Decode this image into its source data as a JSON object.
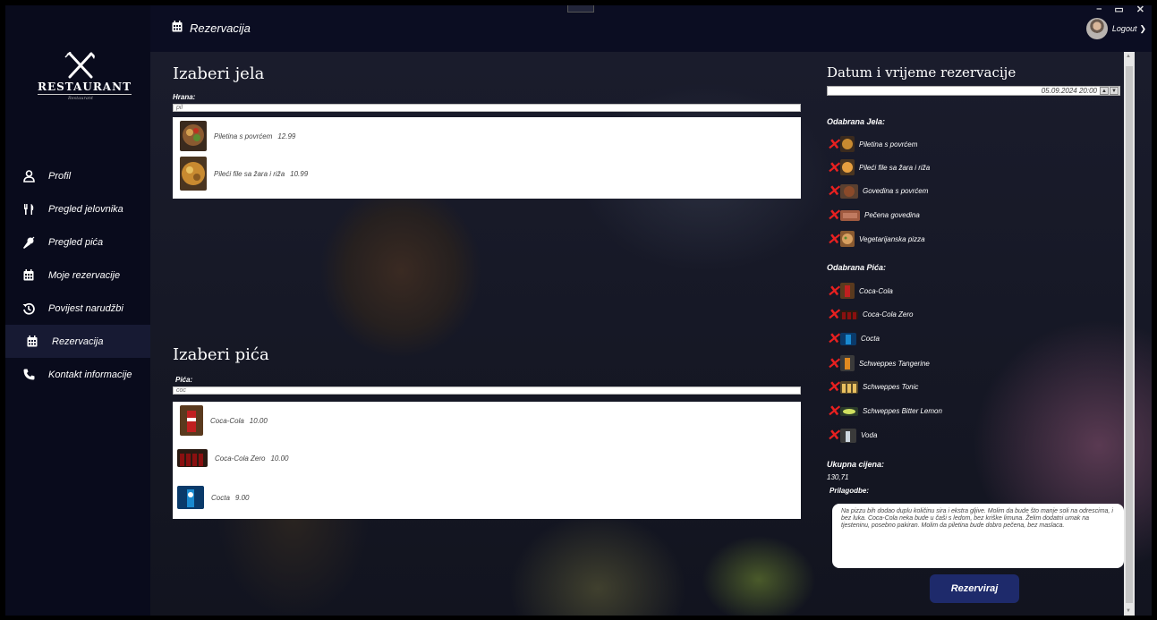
{
  "window": {
    "title": "Rezervacija",
    "controls": [
      "–",
      "▭",
      "✕"
    ]
  },
  "user": {
    "logout_label": "Logout"
  },
  "logo": {
    "brand": "RESTAURANT",
    "tagline": "Restaurant"
  },
  "sidebar": {
    "items": [
      {
        "label": "Profil",
        "icon": "user-icon"
      },
      {
        "label": "Pregled jelovnika",
        "icon": "fork-knife-icon"
      },
      {
        "label": "Pregled pića",
        "icon": "drink-icon"
      },
      {
        "label": "Moje rezervacije",
        "icon": "calendar-icon"
      },
      {
        "label": "Povijest narudžbi",
        "icon": "history-icon"
      },
      {
        "label": "Rezervacija",
        "icon": "calendar-icon"
      },
      {
        "label": "Kontakt informacije",
        "icon": "phone-icon"
      }
    ],
    "active_index": 5
  },
  "food": {
    "heading": "Izaberi jela",
    "label": "Hrana:",
    "search_value": "pil",
    "results": [
      {
        "name": "Piletina s povrćem",
        "price": "12.99"
      },
      {
        "name": "Pileći file sa žara i riža",
        "price": "10.99"
      }
    ]
  },
  "drinks": {
    "heading": "Izaberi pića",
    "label": "Pića:",
    "search_value": "coc",
    "results": [
      {
        "name": "Coca-Cola",
        "price": "10.00"
      },
      {
        "name": "Coca-Cola Zero",
        "price": "10.00"
      },
      {
        "name": "Cocta",
        "price": "9.00"
      }
    ]
  },
  "reservation": {
    "heading": "Datum i vrijeme rezervacije",
    "datetime": "05.09.2024 20:00",
    "selected_food_label": "Odabrana Jela:",
    "selected_food": [
      "Piletina s povrćem",
      "Pileći file sa žara i riža",
      "Govedina s povrćem",
      "Pečena govedina",
      "Vegetarijanska pizza"
    ],
    "selected_drinks_label": "Odabrana Pića:",
    "selected_drinks": [
      "Coca-Cola",
      "Coca-Cola Zero",
      "Cocta",
      "Schweppes Tangerine",
      "Schweppes Tonic",
      "Schweppes Bitter Lemon",
      "Voda"
    ],
    "total_label": "Ukupna cijena:",
    "total_value": "130,71",
    "notes_label": "Prilagodbe:",
    "notes": "Na pizzu bih dodao duplu količinu sira i ekstra gljive. Molim da bude što manje soli na odrescima, i bez luka. Coca-Cola neka bude u čaši s ledom, bez kriške limuna. Želim dodatni umak na tjesteninu, posebno pakiran. Molim da piletina bude dobro pečena, bez maslaca.",
    "submit_label": "Rezerviraj"
  },
  "colors": {
    "remove": "#e82020",
    "button": "#1e2a6b",
    "sidebar": "#090b1c"
  }
}
